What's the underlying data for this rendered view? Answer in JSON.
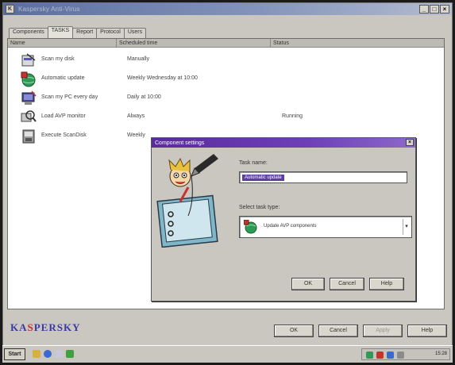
{
  "window": {
    "title": "Kaspersky Anti-Virus",
    "icon_letter": "K",
    "controls": [
      "_",
      "□",
      "×"
    ]
  },
  "tabs": [
    {
      "label": "Components"
    },
    {
      "label": "TASKS",
      "active": true
    },
    {
      "label": "Report"
    },
    {
      "label": "Protocol"
    },
    {
      "label": "Users"
    }
  ],
  "columns": [
    "Name",
    "Scheduled time",
    "Status"
  ],
  "tasks": [
    {
      "name": "Scan my disk",
      "time": "Manually",
      "status": "",
      "icon": "scan-disk-icon"
    },
    {
      "name": "Automatic update",
      "time": "Weekly Wednesday at 10:00",
      "status": "",
      "icon": "globe-update-icon"
    },
    {
      "name": "Scan my PC every day",
      "time": "Daily at 10:00",
      "status": "",
      "icon": "scan-pc-icon"
    },
    {
      "name": "Load AVP monitor",
      "time": "Always",
      "status": "Running",
      "icon": "monitor-magnifier-icon"
    },
    {
      "name": "Execute ScanDisk",
      "time": "Weekly",
      "status": "",
      "icon": "scandisk-icon"
    }
  ],
  "dialog": {
    "title": "Component settings",
    "close": "×",
    "task_name_label": "Task name:",
    "task_name_value": "Automatic update",
    "select_task_label": "Select task type:",
    "task_type_value": "Update AVP components",
    "ok": "OK",
    "cancel": "Cancel",
    "help": "Help"
  },
  "bottom": {
    "logo_left": "KA",
    "logo_accent": "S",
    "logo_right": "PERSKY",
    "ok": "OK",
    "cancel": "Cancel",
    "apply": "Apply",
    "help": "Help"
  },
  "taskbar": {
    "start_label": "Start",
    "clock": "15:28"
  },
  "colors": {
    "dialog_title": "#6e40b8",
    "window_title": "#5a6e9e",
    "logo": "#3c3aa0",
    "logo_accent": "#c8322e"
  }
}
